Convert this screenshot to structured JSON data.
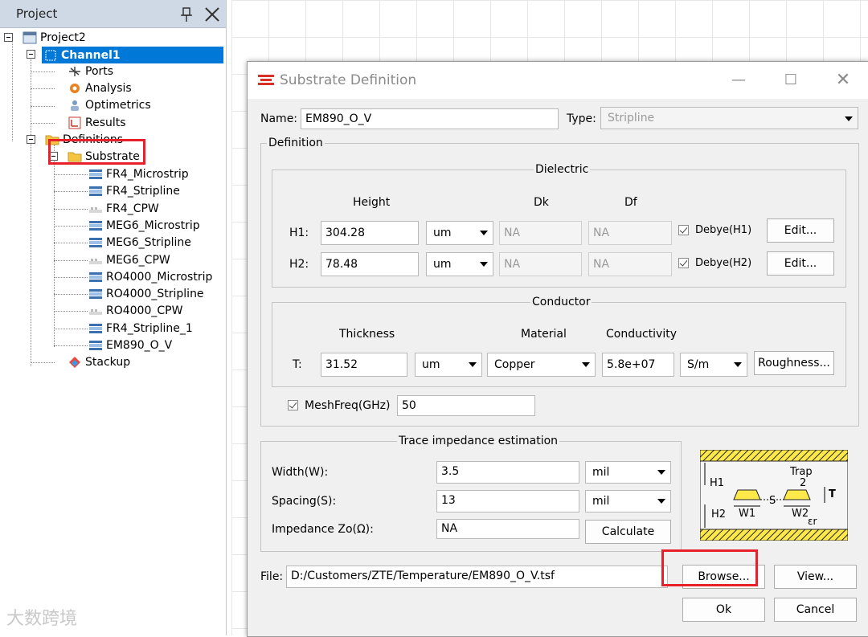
{
  "panel": {
    "title": "Project",
    "tree": {
      "project": "Project2",
      "channel": "Channel1",
      "channel_children": [
        "Ports",
        "Analysis",
        "Optimetrics",
        "Results"
      ],
      "definitions": "Definitions",
      "substrate": "Substrate",
      "substrates": [
        "FR4_Microstrip",
        "FR4_Stripline",
        "FR4_CPW",
        "MEG6_Microstrip",
        "MEG6_Stripline",
        "MEG6_CPW",
        "RO4000_Microstrip",
        "RO4000_Stripline",
        "RO4000_CPW",
        "FR4_Stripline_1",
        "EM890_O_V"
      ],
      "stackup": "Stackup"
    }
  },
  "dialog": {
    "title": "Substrate Definition",
    "name_label": "Name:",
    "name_value": "EM890_O_V",
    "type_label": "Type:",
    "type_value": "Stripline",
    "definition_label": "Definition",
    "dielectric": {
      "title": "Dielectric",
      "headers": [
        "Height",
        "Dk",
        "Df"
      ],
      "rows": [
        {
          "label": "H1:",
          "height": "304.28",
          "unit": "um",
          "dk": "NA",
          "df": "NA",
          "debye": "Debye(H1)",
          "edit": "Edit..."
        },
        {
          "label": "H2:",
          "height": "78.48",
          "unit": "um",
          "dk": "NA",
          "df": "NA",
          "debye": "Debye(H2)",
          "edit": "Edit..."
        }
      ]
    },
    "conductor": {
      "title": "Conductor",
      "headers": [
        "Thickness",
        "Material",
        "Conductivity"
      ],
      "label": "T:",
      "thickness": "31.52",
      "unit": "um",
      "material": "Copper",
      "conductivity": "5.8e+07",
      "cond_unit": "S/m",
      "roughness": "Roughness..."
    },
    "meshfreq_label": "MeshFreq(GHz)",
    "meshfreq_value": "50",
    "trace": {
      "title": "Trace impedance estimation",
      "width_label": "Width(W):",
      "width_value": "3.5",
      "width_unit": "mil",
      "spacing_label": "Spacing(S):",
      "spacing_value": "13",
      "spacing_unit": "mil",
      "impedance_label": "Impedance Zo(Ω):",
      "impedance_value": "NA",
      "calculate": "Calculate"
    },
    "diagram": {
      "h1": "H1",
      "h2": "H2",
      "w1": "W1",
      "w2": "W2",
      "s": "S",
      "trap": "Trap",
      "two": "2",
      "t": "T",
      "er": "εr"
    },
    "file_label": "File:",
    "file_value": "D:/Customers/ZTE/Temperature/EM890_O_V.tsf",
    "browse": "Browse...",
    "view": "View...",
    "ok": "Ok",
    "cancel": "Cancel"
  },
  "watermark": "大数跨境",
  "colors": {
    "selection": "#0078d7",
    "highlight_box": "#e8202a",
    "panel_header": "#cfd9e6",
    "diagram_yellow": "#ffe84a"
  }
}
